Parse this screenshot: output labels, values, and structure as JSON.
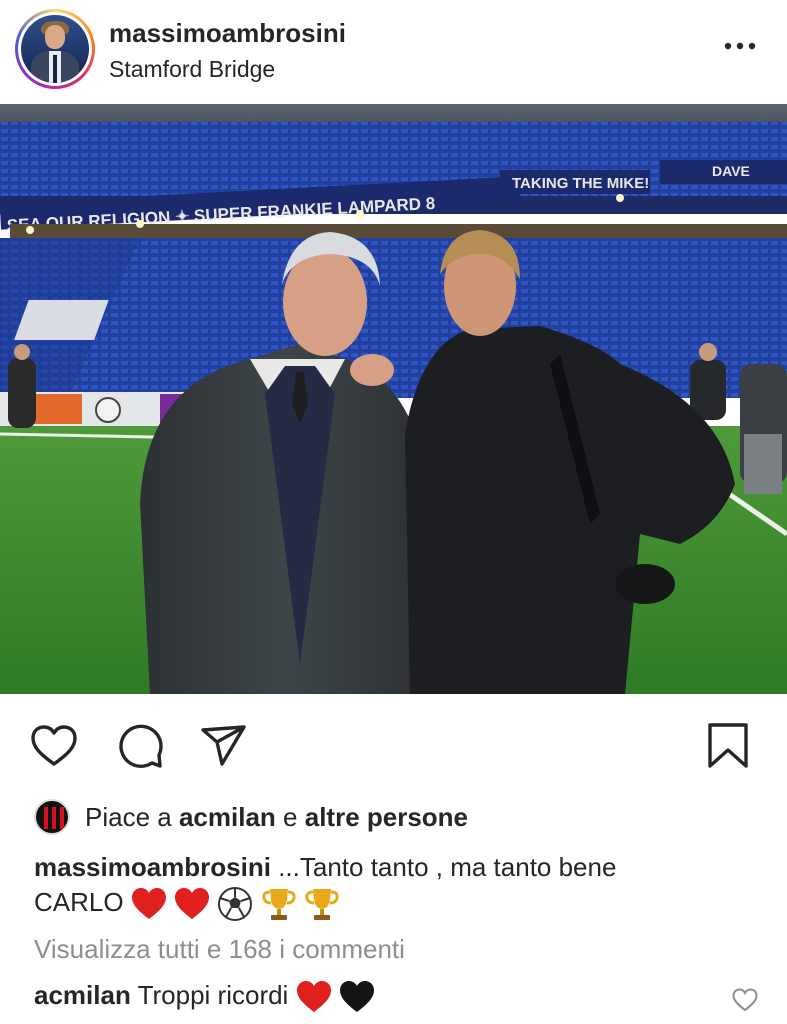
{
  "header": {
    "username": "massimoambrosini",
    "location": "Stamford Bridge",
    "avatar_icon": "profile-photo",
    "more_icon": "more-horizontal-icon"
  },
  "photo": {
    "stadium_banners": [
      "SEA OUR RELIGION",
      "SUPER FRANKIE LAMPARD 8",
      "TAKING THE MIKE!",
      "DAVE"
    ]
  },
  "actions": {
    "like_icon": "heart-outline-icon",
    "comment_icon": "comment-bubble-icon",
    "share_icon": "paper-plane-icon",
    "save_icon": "bookmark-outline-icon"
  },
  "likes": {
    "prefix": "Piace a",
    "user": "acmilan",
    "conjunction": "e",
    "others": "altre persone",
    "avatar_icon": "acmilan-crest"
  },
  "caption": {
    "username": "massimoambrosini",
    "text": " ...Tanto tanto , ma tanto bene",
    "line2": "CARLO",
    "emojis": [
      "red-heart",
      "red-heart",
      "soccer-ball",
      "trophy",
      "trophy"
    ]
  },
  "view_comments": "Visualizza tutti e 168 i commenti",
  "top_comment": {
    "username": "acmilan",
    "text": "Troppi ricordi",
    "emojis": [
      "red-heart",
      "black-heart"
    ],
    "like_icon": "small-heart-outline-icon"
  },
  "colors": {
    "text": "#262626",
    "muted": "#8e8e8e",
    "pitch": "#3f8a2f",
    "seats": "#1f3f9a"
  }
}
